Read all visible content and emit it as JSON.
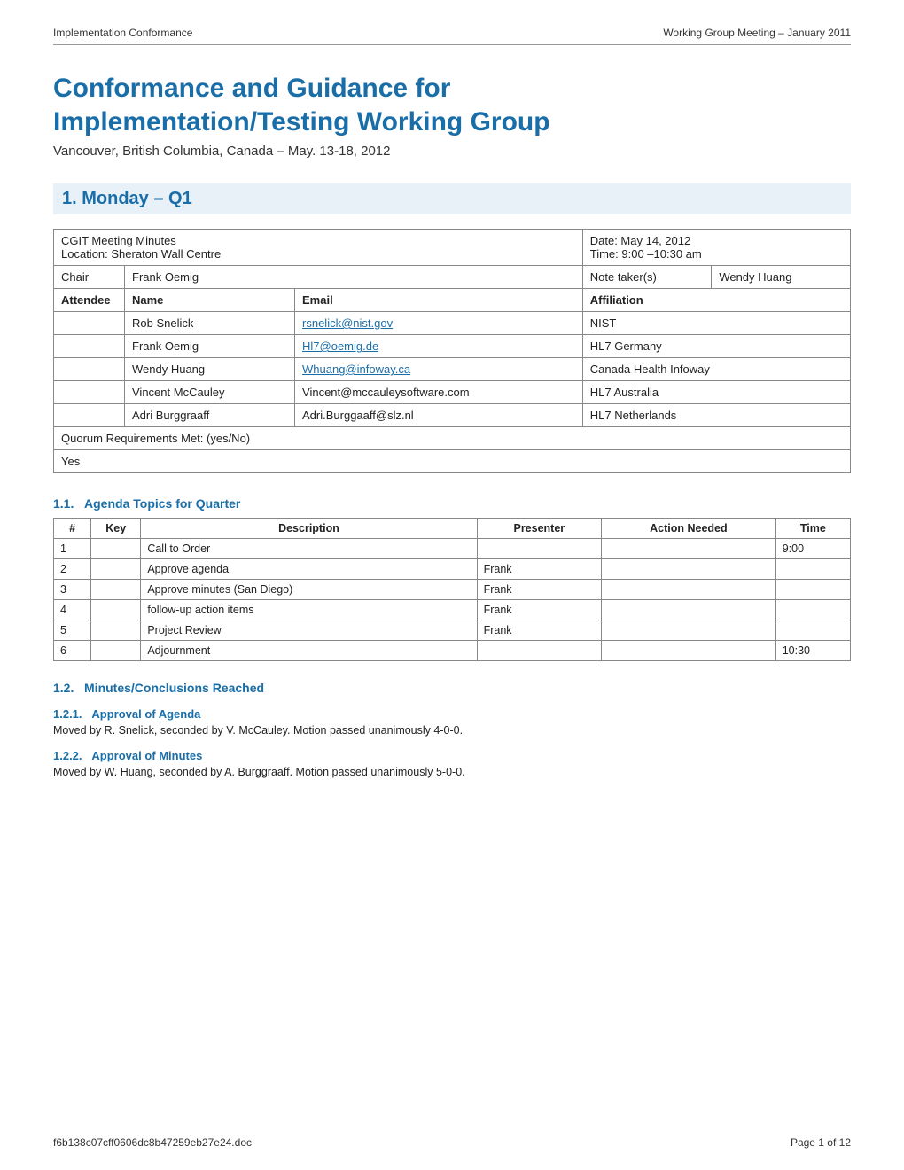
{
  "header": {
    "left": "Implementation Conformance",
    "right": "Working Group Meeting – January 2011"
  },
  "title": {
    "line1": "Conformance and Guidance for",
    "line2": "Implementation/Testing Working Group",
    "subtitle": "Vancouver, British Columbia, Canada – May. 13-18, 2012"
  },
  "section1": {
    "label": "1.  Monday – Q1"
  },
  "meeting_info": {
    "title_left": "CGIT Meeting Minutes",
    "location": "Location: Sheraton Wall Centre",
    "date": "Date: May 14, 2012",
    "time": "Time: 9:00 –10:30 am",
    "chair_label": "Chair",
    "chair_value": "Frank Oemig",
    "note_taker_label": "Note taker(s)",
    "note_taker_value": "Wendy Huang"
  },
  "attendees_headers": [
    "Attendee",
    "Name",
    "Email",
    "Affiliation"
  ],
  "attendees": [
    {
      "name": "Rob Snelick",
      "email": "rsnelick@nist.gov",
      "affiliation": "NIST"
    },
    {
      "name": "Frank Oemig",
      "email": "Hl7@oemig.de",
      "affiliation": "HL7 Germany"
    },
    {
      "name": "Wendy Huang",
      "email": "Whuang@infoway.ca",
      "affiliation": "Canada Health Infoway"
    },
    {
      "name": "Vincent McCauley",
      "email": "Vincent@mccauleysoftware.com",
      "affiliation": "HL7 Australia"
    },
    {
      "name": "Adri Burggraaff",
      "email": "Adri.Burggaaff@slz.nl",
      "affiliation": "HL7 Netherlands"
    }
  ],
  "quorum_label": "Quorum Requirements Met: (yes/No)",
  "quorum_value": "Yes",
  "section1_1": {
    "label": "1.1.   Agenda Topics for Quarter"
  },
  "agenda_headers": [
    "#",
    "Key",
    "Description",
    "Presenter",
    "Action Needed",
    "Time"
  ],
  "agenda_rows": [
    {
      "num": "1",
      "key": "",
      "desc": "Call to Order",
      "presenter": "",
      "action": "",
      "time": "9:00"
    },
    {
      "num": "2",
      "key": "",
      "desc": "Approve agenda",
      "presenter": "Frank",
      "action": "",
      "time": ""
    },
    {
      "num": "3",
      "key": "",
      "desc": "Approve minutes (San Diego)",
      "presenter": "Frank",
      "action": "",
      "time": ""
    },
    {
      "num": "4",
      "key": "",
      "desc": "follow-up action items",
      "presenter": "Frank",
      "action": "",
      "time": ""
    },
    {
      "num": "5",
      "key": "",
      "desc": "Project Review",
      "presenter": "Frank",
      "action": "",
      "time": ""
    },
    {
      "num": "6",
      "key": "",
      "desc": "Adjournment",
      "presenter": "",
      "action": "",
      "time": "10:30"
    }
  ],
  "section1_2": {
    "label": "1.2.   Minutes/Conclusions Reached"
  },
  "section1_2_1": {
    "label": "1.2.1.   Approval of Agenda",
    "text": "Moved by R. Snelick, seconded by V. McCauley. Motion passed unanimously 4-0-0."
  },
  "section1_2_2": {
    "label": "1.2.2.   Approval of Minutes",
    "text": "Moved by W. Huang, seconded by A. Burggraaff. Motion passed unanimously 5-0-0."
  },
  "footer": {
    "left": "f6b138c07cff0606dc8b47259eb27e24.doc",
    "right": "Page 1 of 12"
  }
}
